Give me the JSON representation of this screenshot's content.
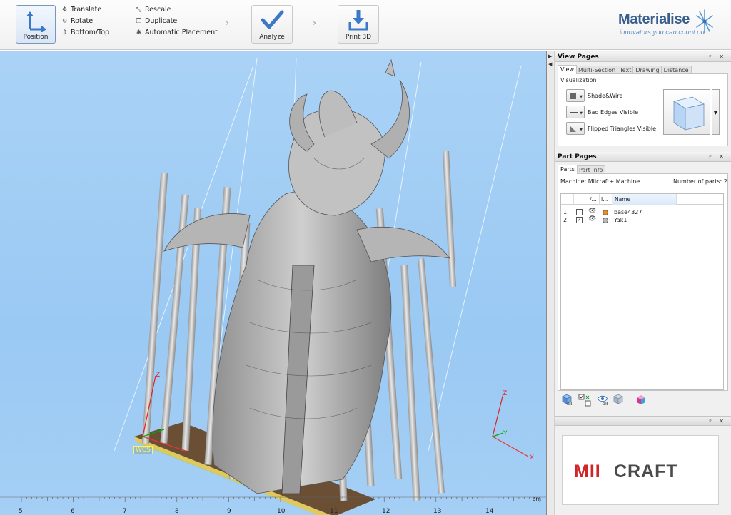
{
  "toolbar": {
    "position_label": "Position",
    "tools_col1": [
      "Translate",
      "Rotate",
      "Bottom/Top"
    ],
    "tools_col2": [
      "Rescale",
      "Duplicate",
      "Automatic Placement"
    ],
    "analyze_label": "Analyze",
    "print_label": "Print 3D"
  },
  "brand": {
    "name": "Materialise",
    "tagline": "innovators you can count on"
  },
  "viewport": {
    "wcs_label": "WCS",
    "axis_z": "Z",
    "axis_y": "Y",
    "axis_x": "X",
    "ruler_ticks": [
      "5",
      "6",
      "7",
      "8",
      "9",
      "10",
      "11",
      "12",
      "13",
      "14"
    ],
    "ruler_unit": "cm"
  },
  "view_pages": {
    "title": "View Pages",
    "tabs": [
      "View",
      "Multi-Section",
      "Text",
      "Drawing",
      "Distance"
    ],
    "active_tab": "View",
    "group_label": "Visualization",
    "options": [
      "Shade&Wire",
      "Bad Edges Visible",
      "Flipped Triangles Visible"
    ]
  },
  "part_pages": {
    "title": "Part Pages",
    "tabs": [
      "Parts",
      "Part Info"
    ],
    "active_tab": "Parts",
    "machine": "Machine: Miicraft+ Machine",
    "count": "Number of parts: 2",
    "columns": [
      "/...",
      "I...",
      "Name"
    ],
    "rows": [
      {
        "num": "1",
        "checked": false,
        "color": "#f08a1a",
        "name": "base4327"
      },
      {
        "num": "2",
        "checked": true,
        "color": "#b8b8b8",
        "name": "Yak1"
      }
    ],
    "toolbar_sub": [
      "all",
      "all"
    ]
  },
  "colors": {
    "accent": "#3a6fb5",
    "viewport_bg": "#9ac9f3",
    "platform": "#6a4f35"
  },
  "sponsor": {
    "logo_text": "MIICRAFT"
  }
}
